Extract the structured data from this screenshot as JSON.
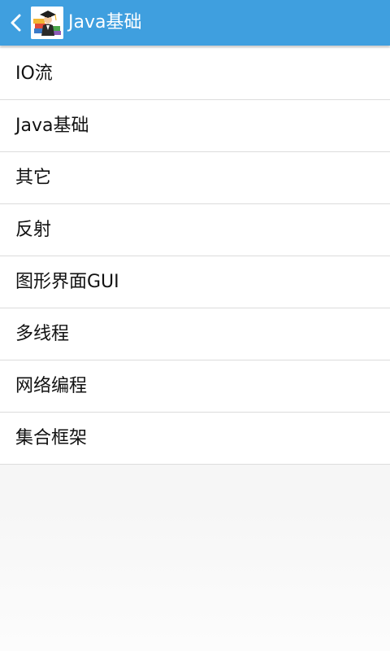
{
  "action_bar": {
    "title": "Java基础",
    "back_icon": "chevron-left-icon",
    "logo_icon": "graduate-books-logo",
    "color": "#3f9fdf"
  },
  "list": {
    "items": [
      {
        "label": "IO流"
      },
      {
        "label": "Java基础"
      },
      {
        "label": "其它"
      },
      {
        "label": "反射"
      },
      {
        "label": "图形界面GUI"
      },
      {
        "label": "多线程"
      },
      {
        "label": "网络编程"
      },
      {
        "label": "集合框架"
      }
    ]
  }
}
